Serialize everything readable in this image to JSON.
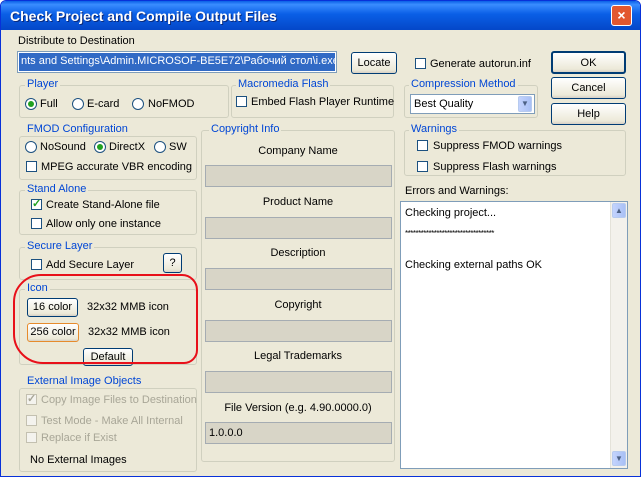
{
  "window": {
    "title": "Check Project and Compile Output Files",
    "close": "×"
  },
  "distribute": {
    "label": "Distribute to Destination",
    "path": "nts and Settings\\Admin.MICROSOF-BE5E72\\Рабочий стол\\i.exe",
    "locate": "Locate"
  },
  "autorun": {
    "label": "Generate autorun.inf",
    "checked": false
  },
  "actions": {
    "ok": "OK",
    "cancel": "Cancel",
    "help": "Help"
  },
  "player": {
    "title": "Player",
    "options": [
      "Full",
      "E-card",
      "NoFMOD"
    ],
    "selected": "Full"
  },
  "flash": {
    "title": "Macromedia Flash",
    "embed": "Embed Flash Player Runtime",
    "checked": false
  },
  "compression": {
    "title": "Compression Method",
    "value": "Best Quality"
  },
  "fmod": {
    "title": "FMOD Configuration",
    "options": [
      "NoSound",
      "DirectX",
      "SW"
    ],
    "selected": "DirectX",
    "mpeg": "MPEG accurate VBR encoding"
  },
  "copyright_info": {
    "title": "Copyright Info",
    "company": "Company Name",
    "product": "Product Name",
    "description": "Description",
    "copyright": "Copyright",
    "trademarks": "Legal Trademarks",
    "file_version_label": "File Version (e.g. 4.90.0000.0)",
    "file_version": "1.0.0.0"
  },
  "warnings": {
    "title": "Warnings",
    "fmod": "Suppress FMOD warnings",
    "flash": "Suppress Flash warnings"
  },
  "errors": {
    "label": "Errors and Warnings:",
    "lines": [
      "Checking project...",
      "**********************************",
      "Checking external paths OK"
    ]
  },
  "standalone": {
    "title": "Stand Alone",
    "create": "Create Stand-Alone file",
    "only_one": "Allow only one instance"
  },
  "secure": {
    "title": "Secure Layer",
    "add": "Add Secure Layer",
    "help": "?"
  },
  "icon": {
    "title": "Icon",
    "btn16": "16 color",
    "label16": "32x32 MMB icon",
    "btn256": "256 color",
    "label256": "32x32 MMB icon",
    "default": "Default",
    "highlight_color": "#e8101a"
  },
  "external": {
    "title": "External Image Objects",
    "copy": "Copy Image Files to Destination",
    "test": "Test Mode - Make All Internal",
    "replace": "Replace if Exist",
    "none": "No External Images"
  },
  "colors": {
    "title_bar": "#0a5fe6",
    "dialog_bg": "#ece9d8",
    "group_label": "#0046d5",
    "check_mark": "#21a121"
  }
}
